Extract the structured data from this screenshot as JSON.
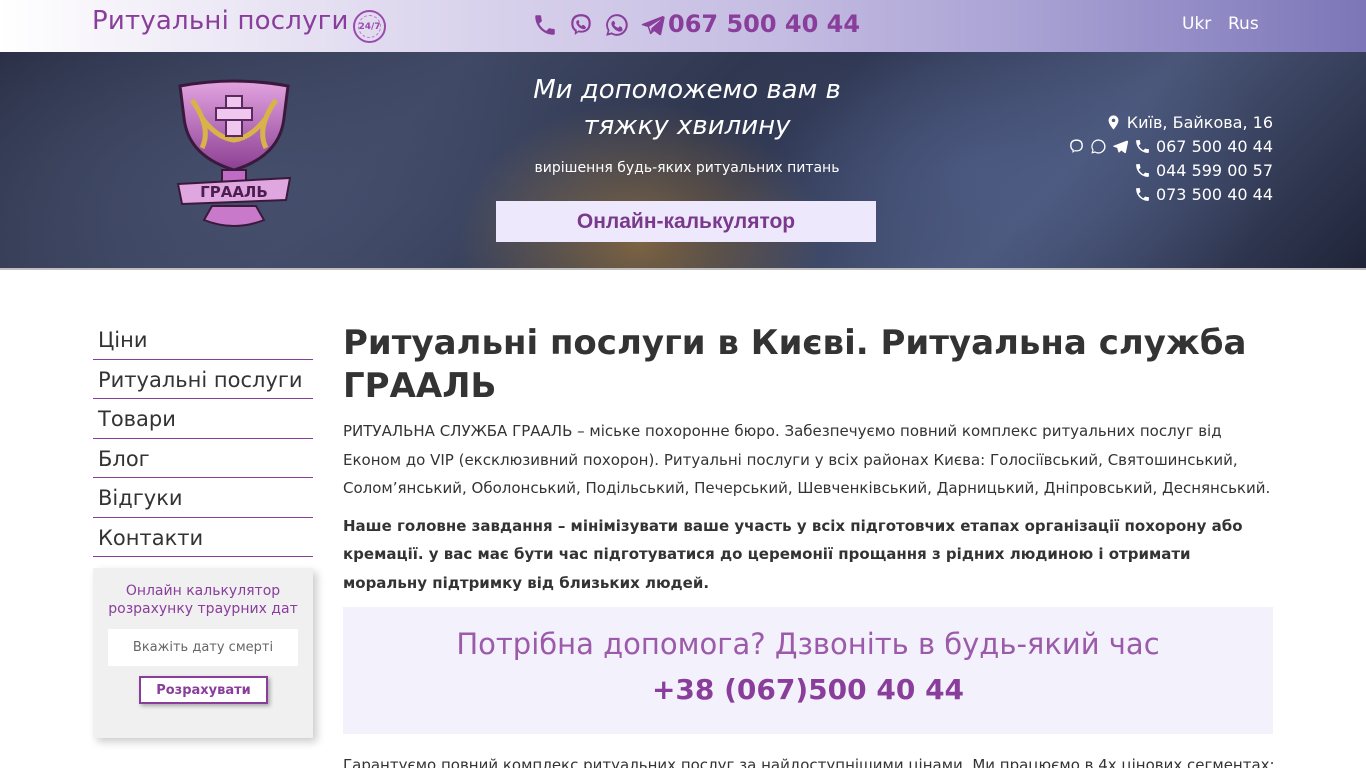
{
  "topbar": {
    "brand": "Ритуальні послуги",
    "badge": "24/7",
    "phone": "067 500 40 44",
    "lang_ukr": "Ukr",
    "lang_rus": "Rus",
    "icons": [
      "phone-icon",
      "viber-icon",
      "whatsapp-icon",
      "telegram-icon"
    ]
  },
  "hero": {
    "logo_text": "ГРААЛЬ",
    "slogan": "Ми допоможемо вам в тяжку хвилину",
    "subslogan": "вирішення будь-яких ритуальних питань",
    "calc_button": "Онлайн-калькулятор",
    "address": "Київ, Байкова, 16",
    "phones": [
      "067 500 40 44",
      "044 599 00 57",
      "073 500 40 44"
    ]
  },
  "sidebar": {
    "items": [
      {
        "label": "Ціни"
      },
      {
        "label": "Ритуальні послуги"
      },
      {
        "label": "Товари"
      },
      {
        "label": "Блог"
      },
      {
        "label": "Відгуки"
      },
      {
        "label": "Контакти"
      }
    ],
    "calc": {
      "title": "Онлайн калькулятор розрахунку траурних дат",
      "placeholder": "Вкажіть дату смерті",
      "submit": "Розрахувати"
    }
  },
  "main": {
    "title": "Ритуальні послуги в Києві. Ритуальна служба ГРААЛЬ",
    "para1": "РИТУАЛЬНА СЛУЖБА ГРААЛЬ – міське похоронне бюро. Забезпечуємо повний комплекс ритуальних послуг від Економ до VIP (ексклюзивний похорон). Ритуальні послуги у всіх районах Києва: Голосіївський, Святошинський, Солом’янський, Оболонський, Подільський, Печерський, Шевченківський, Дарницький, Дніпровський, Деснянський.",
    "para2": "Наше головне завдання – мінімізувати ваше участь у всіх підготовчих етапах організації похорону або кремації. у вас має бути час підготуватися до церемонії прощання з рідних людиною і отримати моральну підтримку від близьких людей.",
    "help_text": "Потрібна допомога? Дзвоніть в будь-який час",
    "help_phone": "+38 (067)500 40 44",
    "bottom_text": "Гарантуємо повний комплекс ритуальних послуг за найдоступнішими цінами. Ми працюємо в 4х цінових сегментах:"
  },
  "colors": {
    "accent": "#8a3e9b",
    "help_bg": "#f3f1fb",
    "calc_bg": "#ede8fb"
  }
}
